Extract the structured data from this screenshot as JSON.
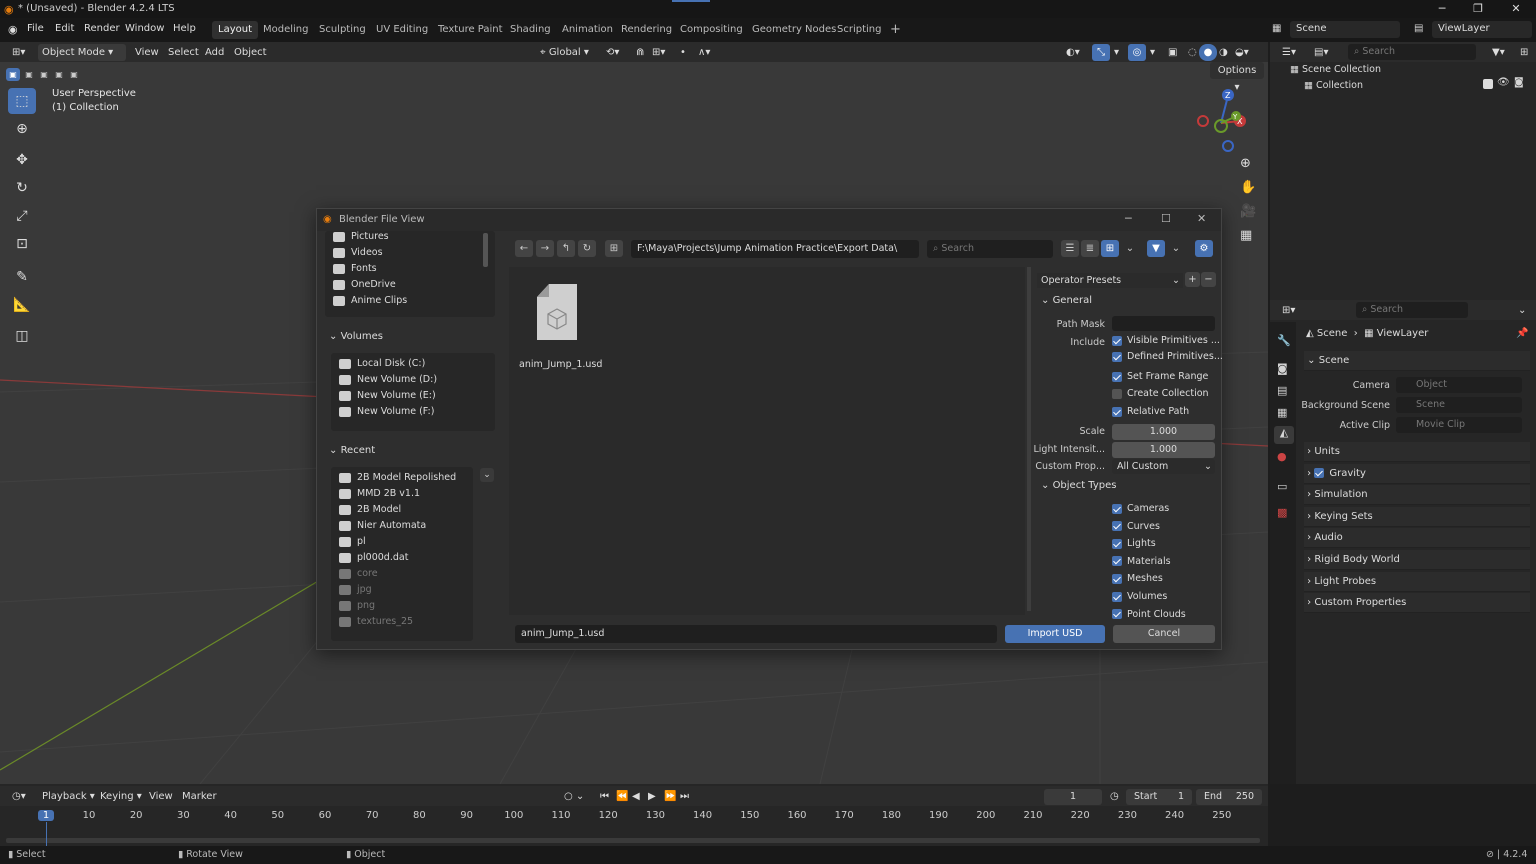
{
  "window": {
    "title": "* (Unsaved) - Blender 4.2.4 LTS"
  },
  "menu": [
    "File",
    "Edit",
    "Render",
    "Window",
    "Help"
  ],
  "workspaces": [
    "Layout",
    "Modeling",
    "Sculpting",
    "UV Editing",
    "Texture Paint",
    "Shading",
    "Animation",
    "Rendering",
    "Compositing",
    "Geometry Nodes",
    "Scripting"
  ],
  "active_workspace": "Layout",
  "scene": {
    "name": "Scene",
    "view_layer": "ViewLayer"
  },
  "viewport": {
    "mode": "Object Mode",
    "menus": [
      "View",
      "Select",
      "Add",
      "Object"
    ],
    "transform": "Global",
    "overlay_line1": "User Perspective",
    "overlay_line2": "(1) Collection",
    "options_label": "Options",
    "gizmo_axes": {
      "x": "X",
      "y": "Y",
      "z": "Z"
    }
  },
  "dialog": {
    "title": "Blender File View",
    "path": "F:\\Maya\\Projects\\Jump Animation Practice\\Export Data\\",
    "search_placeholder": "Search",
    "system_items": [
      "Pictures",
      "Videos",
      "Fonts",
      "OneDrive",
      "Anime Clips"
    ],
    "volumes_header": "Volumes",
    "volumes": [
      "Local Disk (C:)",
      "New Volume (D:)",
      "New Volume (E:)",
      "New Volume (F:)"
    ],
    "recent_header": "Recent",
    "recent": [
      {
        "label": "2B Model Repolished",
        "dim": false
      },
      {
        "label": "MMD 2B v1.1",
        "dim": false
      },
      {
        "label": "2B Model",
        "dim": false
      },
      {
        "label": "Nier Automata",
        "dim": false
      },
      {
        "label": "pl",
        "dim": false
      },
      {
        "label": "pl000d.dat",
        "dim": false
      },
      {
        "label": "core",
        "dim": true
      },
      {
        "label": "jpg",
        "dim": true
      },
      {
        "label": "png",
        "dim": true
      },
      {
        "label": "textures_25",
        "dim": true
      }
    ],
    "file_name": "anim_Jump_1.usd",
    "filename_field": "anim_Jump_1.usd",
    "import_button": "Import USD",
    "cancel_button": "Cancel",
    "operator_presets": "Operator Presets",
    "general_header": "General",
    "path_mask_label": "Path Mask",
    "include_label": "Include",
    "include_options": [
      {
        "label": "Visible Primitives ...",
        "checked": true
      },
      {
        "label": "Defined Primitives...",
        "checked": true
      },
      {
        "label": "Set Frame Range",
        "checked": true
      },
      {
        "label": "Create Collection",
        "checked": false
      },
      {
        "label": "Relative Path",
        "checked": true
      }
    ],
    "scale_label": "Scale",
    "scale_value": "1.000",
    "light_label": "Light Intensit...",
    "light_value": "1.000",
    "custom_prop_label": "Custom Prop...",
    "custom_prop_value": "All Custom",
    "object_types_header": "Object Types",
    "object_types": [
      "Cameras",
      "Curves",
      "Lights",
      "Materials",
      "Meshes",
      "Volumes",
      "Point Clouds"
    ]
  },
  "outliner": {
    "search_placeholder": "Search",
    "scene_collection": "Scene Collection",
    "collection": "Collection"
  },
  "properties": {
    "search_placeholder": "Search",
    "breadcrumb_scene": "Scene",
    "breadcrumb_layer": "ViewLayer",
    "scene_header": "Scene",
    "camera_label": "Camera",
    "camera_placeholder": "Object",
    "background_label": "Background Scene",
    "background_placeholder": "Scene",
    "clip_label": "Active Clip",
    "clip_placeholder": "Movie Clip",
    "panels": [
      "Units",
      "Gravity",
      "Simulation",
      "Keying Sets",
      "Audio",
      "Rigid Body World",
      "Light Probes",
      "Custom Properties"
    ]
  },
  "timeline": {
    "menus": [
      "Playback",
      "Keying",
      "View",
      "Marker"
    ],
    "current_frame": "1",
    "start_label": "Start",
    "start": "1",
    "end_label": "End",
    "end": "250",
    "ticks": [
      "1",
      "10",
      "20",
      "30",
      "40",
      "50",
      "60",
      "70",
      "80",
      "90",
      "100",
      "110",
      "120",
      "130",
      "140",
      "150",
      "160",
      "170",
      "180",
      "190",
      "200",
      "210",
      "220",
      "230",
      "240",
      "250"
    ]
  },
  "status": {
    "select": "Select",
    "rotate": "Rotate View",
    "object": "Object",
    "version": "4.2.4"
  },
  "colors": {
    "accent": "#4772b3",
    "viewport_bg": "#393939",
    "panel_bg": "#2e2e2e"
  }
}
